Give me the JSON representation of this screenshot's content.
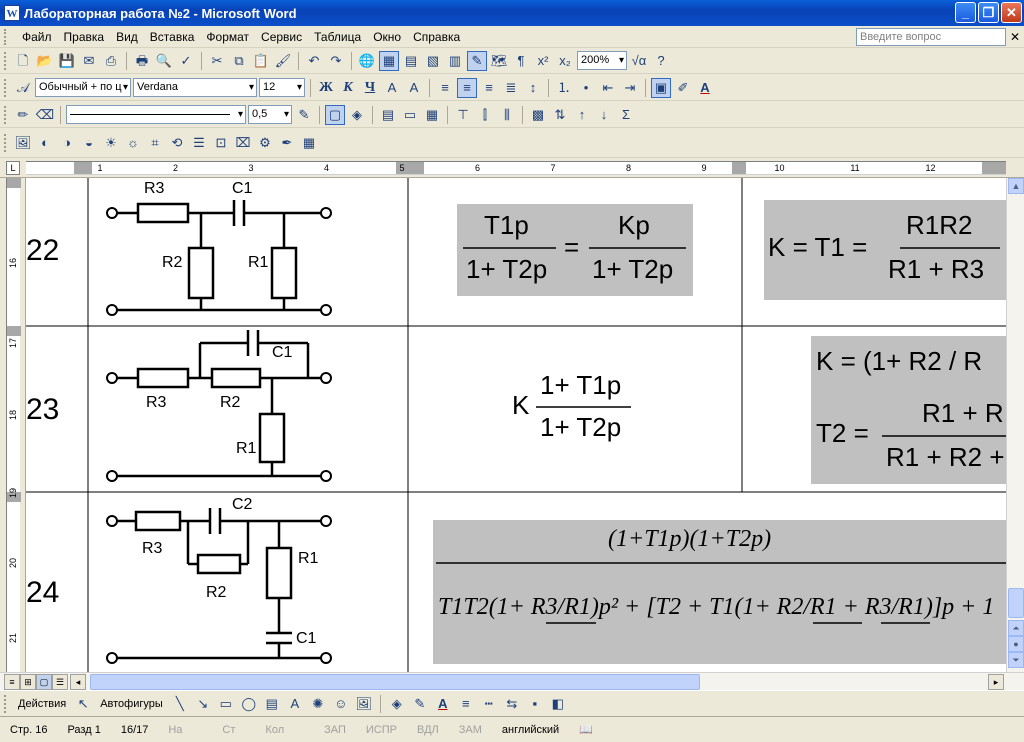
{
  "window": {
    "title": "Лабораторная работа №2 - Microsoft Word",
    "app_icon": "W",
    "buttons": [
      "_",
      "❐",
      "✕"
    ]
  },
  "menu": {
    "items": [
      "Файл",
      "Правка",
      "Вид",
      "Вставка",
      "Формат",
      "Сервис",
      "Таблица",
      "Окно",
      "Справка"
    ],
    "help_placeholder": "Введите вопрос"
  },
  "toolbar_standard": {
    "zoom": "200%"
  },
  "toolbar_format": {
    "style": "Обычный + по ц",
    "font": "Verdana",
    "size": "12",
    "bold": "Ж",
    "italic": "К",
    "underline": "Ч"
  },
  "toolbar_tables": {
    "line_weight": "0,5"
  },
  "ruler": {
    "numbers": [
      "1",
      "2",
      "3",
      "4",
      "5",
      "6",
      "7",
      "8",
      "9",
      "10",
      "11",
      "12"
    ],
    "v_numbers": [
      "16",
      "17",
      "18",
      "19",
      "20",
      "21"
    ]
  },
  "table": {
    "rows": [
      {
        "num": "22",
        "labels": [
          "R3",
          "C1",
          "R2",
          "R1"
        ],
        "tf_num": "T1p",
        "tf_num2": "Kp",
        "tf_den": "1+ T2p",
        "param": "K = T1 =",
        "param_num": "R1R2",
        "param_den": "R1 + R3"
      },
      {
        "num": "23",
        "labels": [
          "C1",
          "R3",
          "R2",
          "R1"
        ],
        "tf_prefix": "K",
        "tf_num": "1+ T1p",
        "tf_den": "1+ T2p",
        "param_line1": "K = (1+ R2 / R",
        "param_t2": "T2 =",
        "param_num": "R1 + R",
        "param_den": "R1 + R2 +"
      },
      {
        "num": "24",
        "labels": [
          "C2",
          "R3",
          "R2",
          "R1",
          "C1"
        ],
        "tf_num": "(1+T1p)(1+T2p)",
        "tf_den": "T1T2(1+ R3/R1)p² + [T2 + T1(1+ R2/R1 + R3/R1)]p + 1"
      }
    ]
  },
  "drawing": {
    "actions": "Действия",
    "autoshapes": "Автофигуры"
  },
  "status": {
    "page": "Стр. 16",
    "section": "Разд 1",
    "pages": "16/17",
    "at": "На",
    "line": "Ст",
    "col": "Кол",
    "rec": "ЗАП",
    "trk": "ИСПР",
    "ext": "ВДЛ",
    "ovr": "ЗАМ",
    "language": "английский"
  },
  "colors": {
    "titlebar": "#0a4fc9",
    "formula_bg": "#c0c0c0"
  }
}
